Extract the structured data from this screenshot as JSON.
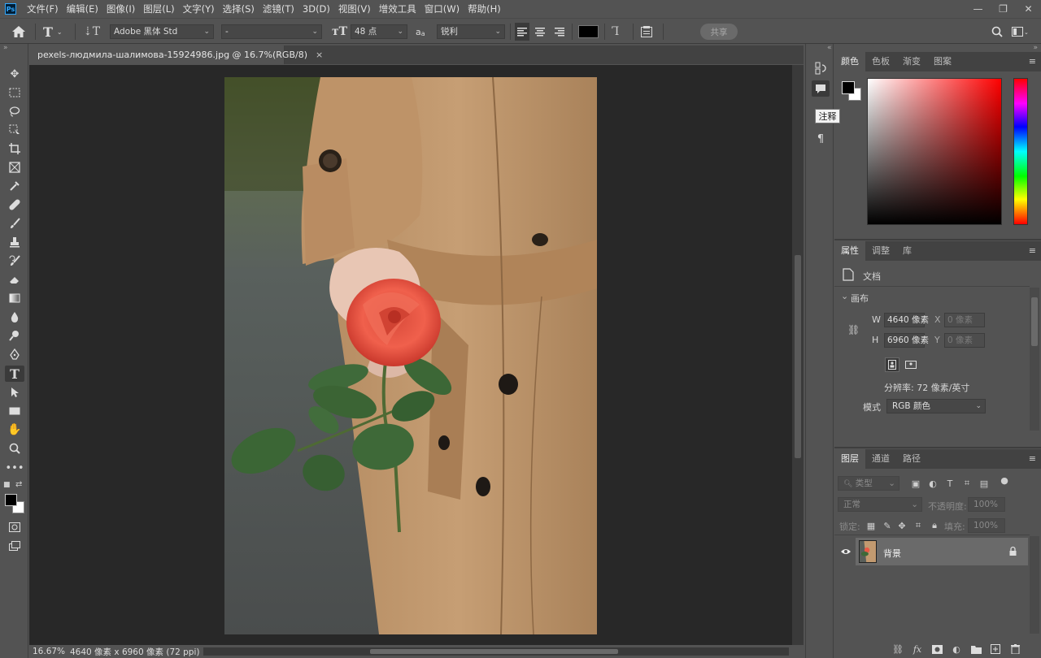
{
  "app": {
    "logo": "Ps"
  },
  "menu": [
    "文件(F)",
    "编辑(E)",
    "图像(I)",
    "图层(L)",
    "文字(Y)",
    "选择(S)",
    "滤镜(T)",
    "3D(D)",
    "视图(V)",
    "增效工具",
    "窗口(W)",
    "帮助(H)"
  ],
  "window_controls": {
    "minimize": "—",
    "restore": "❐",
    "close": "✕"
  },
  "options": {
    "font_family": "Adobe 黑体 Std",
    "font_style": "-",
    "font_size": "48 点",
    "aa_icon_label": "a",
    "antialias": "锐利",
    "share_label": "共享",
    "text_color": "#000000"
  },
  "document": {
    "tab_title": "pexels-людмила-шалимова-15924986.jpg @ 16.7%(RGB/8)",
    "close_glyph": "×"
  },
  "status": {
    "zoom": "16.67%",
    "info": "4640 像素 x 6960 像素 (72 ppi)",
    "arrow": "›"
  },
  "tooltip": "注释",
  "color_panel": {
    "tabs": [
      "颜色",
      "色板",
      "渐变",
      "图案"
    ],
    "active": 0,
    "foreground": "#000000",
    "background": "#ffffff"
  },
  "properties_panel": {
    "tabs": [
      "属性",
      "调整",
      "库"
    ],
    "active": 0,
    "doc_label": "文档",
    "section": "画布",
    "w_label": "W",
    "w_value": "4640 像素",
    "h_label": "H",
    "h_value": "6960 像素",
    "x_label": "X",
    "x_value": "0 像素",
    "y_label": "Y",
    "y_value": "0 像素",
    "resolution": "分辨率: 72 像素/英寸",
    "mode_label": "模式",
    "mode_value": "RGB 颜色"
  },
  "layers_panel": {
    "tabs": [
      "图层",
      "通道",
      "路径"
    ],
    "active": 0,
    "filter_kind": "类型",
    "blend_mode": "正常",
    "opacity_label": "不透明度:",
    "opacity_value": "100%",
    "lock_label": "锁定:",
    "fill_label": "填充:",
    "fill_value": "100%",
    "layers": [
      {
        "name": "背景",
        "visible": true,
        "locked": true
      }
    ]
  }
}
